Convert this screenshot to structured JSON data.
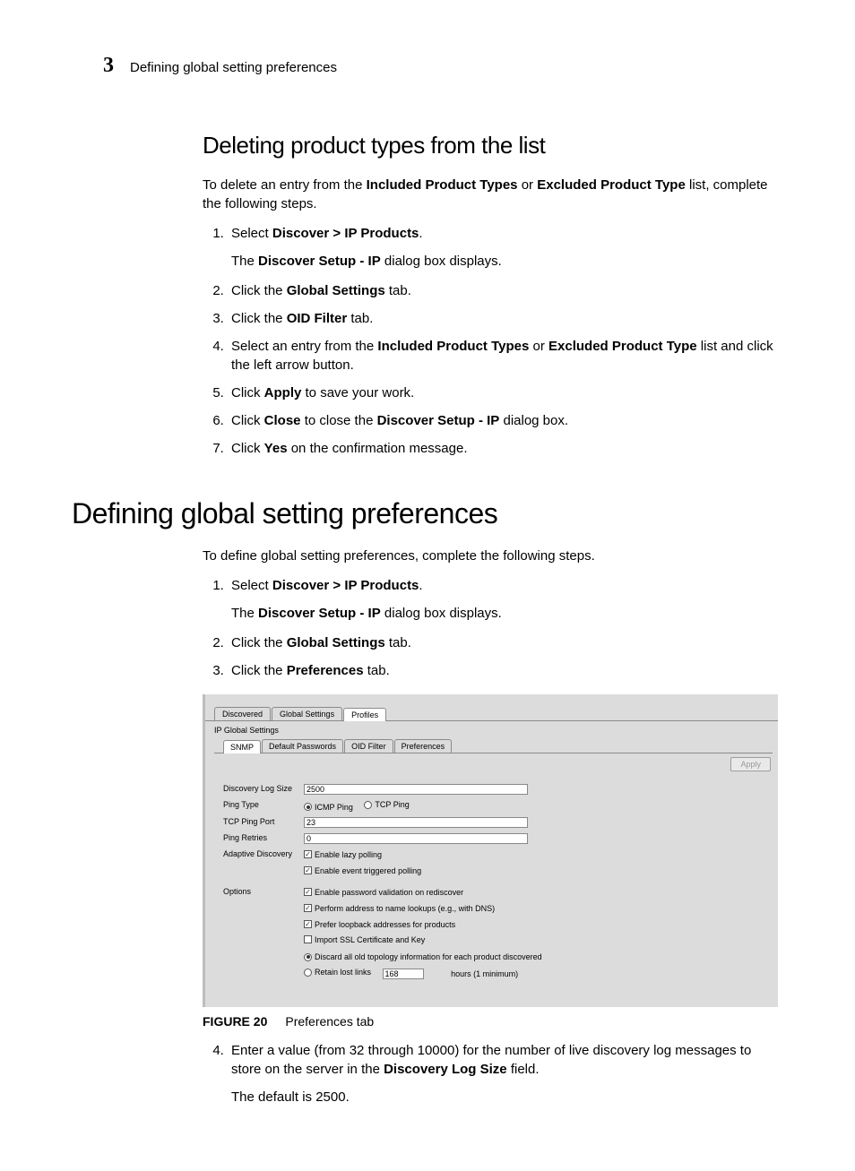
{
  "header": {
    "chapter_number": "3",
    "running_title": "Defining global setting preferences"
  },
  "section1": {
    "heading": "Deleting product types from the list",
    "intro_before": "To delete an entry from the ",
    "intro_b1": "Included Product Types",
    "intro_mid": " or ",
    "intro_b2": "Excluded Product Type",
    "intro_after": " list, complete the following steps.",
    "steps": {
      "s1a": "Select ",
      "s1b": "Discover > IP Products",
      "s1c": ".",
      "s1sub_a": "The ",
      "s1sub_b": "Discover Setup - IP",
      "s1sub_c": " dialog box displays.",
      "s2a": "Click the ",
      "s2b": "Global Settings",
      "s2c": " tab.",
      "s3a": "Click the ",
      "s3b": "OID Filter",
      "s3c": " tab.",
      "s4a": "Select an entry from the ",
      "s4b": "Included Product Types",
      "s4c": " or ",
      "s4d": "Excluded Product Type",
      "s4e": " list and click the left arrow button.",
      "s5a": "Click ",
      "s5b": "Apply",
      "s5c": " to save your work.",
      "s6a": "Click ",
      "s6b": "Close",
      "s6c": " to close the ",
      "s6d": "Discover Setup - IP",
      "s6e": " dialog box.",
      "s7a": "Click ",
      "s7b": "Yes",
      "s7c": " on the confirmation message."
    }
  },
  "section2": {
    "heading": "Defining global setting preferences",
    "intro": "To define global setting preferences, complete the following steps.",
    "steps": {
      "s1a": "Select ",
      "s1b": "Discover > IP Products",
      "s1c": ".",
      "s1sub_a": "The ",
      "s1sub_b": "Discover Setup - IP",
      "s1sub_c": " dialog box displays.",
      "s2a": "Click the ",
      "s2b": "Global Settings",
      "s2c": " tab.",
      "s3a": "Click the ",
      "s3b": "Preferences",
      "s3c": " tab.",
      "s4a": "Enter a value (from 32 through 10000) for the number of live discovery log messages to store on the server in the ",
      "s4b": "Discovery Log Size",
      "s4c": " field.",
      "s4sub": "The default is 2500."
    }
  },
  "figure": {
    "label": "FIGURE 20",
    "caption": "Preferences tab"
  },
  "screenshot": {
    "top_tabs": {
      "t1": "Discovered",
      "t2": "Global Settings",
      "t3": "Profiles"
    },
    "title": "IP Global Settings",
    "inner_tabs": {
      "t1": "SNMP",
      "t2": "Default Passwords",
      "t3": "OID Filter",
      "t4": "Preferences"
    },
    "apply": "Apply",
    "labels": {
      "disc_log": "Discovery Log Size",
      "ping_type": "Ping Type",
      "tcp_port": "TCP Ping Port",
      "ping_retries": "Ping Retries",
      "adaptive": "Adaptive Discovery",
      "options": "Options"
    },
    "values": {
      "disc_log": "2500",
      "tcp_port": "23",
      "ping_retries": "0",
      "retain_hours": "168"
    },
    "radios": {
      "icmp": "ICMP Ping",
      "tcp": "TCP Ping"
    },
    "checks": {
      "lazy": "Enable lazy polling",
      "event": "Enable event triggered polling",
      "pwval": "Enable password validation on rediscover",
      "dns": "Perform address to name lookups (e.g., with DNS)",
      "loopback": "Prefer loopback addresses for products",
      "ssl": "Import SSL Certificate and Key"
    },
    "opt_radios": {
      "discard": "Discard all old topology information for each product discovered",
      "retain_a": "Retain lost links",
      "retain_b": "hours (1 minimum)"
    }
  }
}
